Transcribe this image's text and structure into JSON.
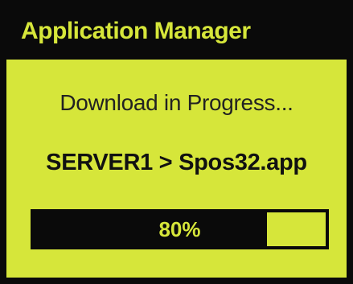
{
  "window": {
    "title": "Application Manager"
  },
  "dialog": {
    "status_text": "Download in Progress...",
    "path_text": "SERVER1 > Spos32.app"
  },
  "progress": {
    "value_percent": 80,
    "label": "80%"
  },
  "colors": {
    "screen_background": "#d6e63a",
    "frame": "#0a0a0a",
    "title_text": "#d6e63a",
    "progress_fill": "#0a0a0a",
    "progress_label": "#d6e63a"
  }
}
